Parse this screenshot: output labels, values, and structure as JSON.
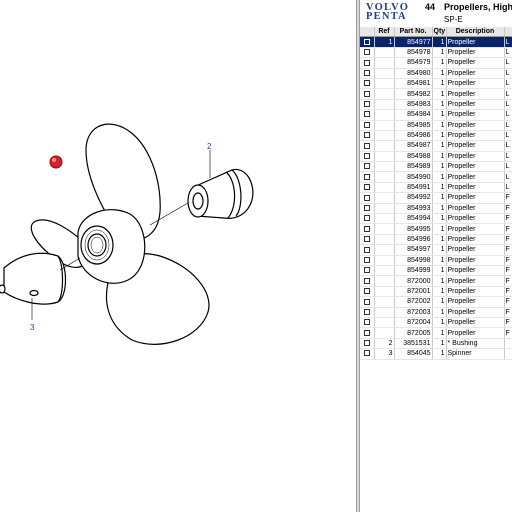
{
  "header": {
    "brand_line1": "VOLVO",
    "brand_line2": "PENTA",
    "group_no": "44",
    "title": "Propellers, High",
    "subtitle": "SP-E"
  },
  "columns": [
    "Ref",
    "Part No.",
    "Qty",
    "Description"
  ],
  "rows": [
    {
      "ref": "1",
      "part": "854977",
      "qty": "1",
      "desc": "Propeller",
      "extra": "L",
      "selected": true
    },
    {
      "ref": "",
      "part": "854978",
      "qty": "1",
      "desc": "Propeller",
      "extra": "L"
    },
    {
      "ref": "",
      "part": "854979",
      "qty": "1",
      "desc": "Propeller",
      "extra": "L"
    },
    {
      "ref": "",
      "part": "854980",
      "qty": "1",
      "desc": "Propeller",
      "extra": "L"
    },
    {
      "ref": "",
      "part": "854981",
      "qty": "1",
      "desc": "Propeller",
      "extra": "L"
    },
    {
      "ref": "",
      "part": "854982",
      "qty": "1",
      "desc": "Propeller",
      "extra": "L"
    },
    {
      "ref": "",
      "part": "854983",
      "qty": "1",
      "desc": "Propeller",
      "extra": "L"
    },
    {
      "ref": "",
      "part": "854984",
      "qty": "1",
      "desc": "Propeller",
      "extra": "L"
    },
    {
      "ref": "",
      "part": "854985",
      "qty": "1",
      "desc": "Propeller",
      "extra": "L"
    },
    {
      "ref": "",
      "part": "854986",
      "qty": "1",
      "desc": "Propeller",
      "extra": "L"
    },
    {
      "ref": "",
      "part": "854987",
      "qty": "1",
      "desc": "Propeller",
      "extra": "L"
    },
    {
      "ref": "",
      "part": "854988",
      "qty": "1",
      "desc": "Propeller",
      "extra": "L"
    },
    {
      "ref": "",
      "part": "854989",
      "qty": "1",
      "desc": "Propeller",
      "extra": "L"
    },
    {
      "ref": "",
      "part": "854990",
      "qty": "1",
      "desc": "Propeller",
      "extra": "L"
    },
    {
      "ref": "",
      "part": "854991",
      "qty": "1",
      "desc": "Propeller",
      "extra": "L"
    },
    {
      "ref": "",
      "part": "854992",
      "qty": "1",
      "desc": "Propeller",
      "extra": "F"
    },
    {
      "ref": "",
      "part": "854993",
      "qty": "1",
      "desc": "Propeller",
      "extra": "F"
    },
    {
      "ref": "",
      "part": "854994",
      "qty": "1",
      "desc": "Propeller",
      "extra": "F"
    },
    {
      "ref": "",
      "part": "854995",
      "qty": "1",
      "desc": "Propeller",
      "extra": "F"
    },
    {
      "ref": "",
      "part": "854996",
      "qty": "1",
      "desc": "Propeller",
      "extra": "F"
    },
    {
      "ref": "",
      "part": "854997",
      "qty": "1",
      "desc": "Propeller",
      "extra": "F"
    },
    {
      "ref": "",
      "part": "854998",
      "qty": "1",
      "desc": "Propeller",
      "extra": "F"
    },
    {
      "ref": "",
      "part": "854999",
      "qty": "1",
      "desc": "Propeller",
      "extra": "F"
    },
    {
      "ref": "",
      "part": "872000",
      "qty": "1",
      "desc": "Propeller",
      "extra": "F"
    },
    {
      "ref": "",
      "part": "872001",
      "qty": "1",
      "desc": "Propeller",
      "extra": "F"
    },
    {
      "ref": "",
      "part": "872002",
      "qty": "1",
      "desc": "Propeller",
      "extra": "F"
    },
    {
      "ref": "",
      "part": "872003",
      "qty": "1",
      "desc": "Propeller",
      "extra": "F"
    },
    {
      "ref": "",
      "part": "872004",
      "qty": "1",
      "desc": "Propeller",
      "extra": "F"
    },
    {
      "ref": "",
      "part": "872005",
      "qty": "1",
      "desc": "Propeller",
      "extra": "F"
    },
    {
      "ref": "2",
      "part": "3851531",
      "qty": "1",
      "desc": "* Bushing",
      "extra": ""
    },
    {
      "ref": "3",
      "part": "854045",
      "qty": "1",
      "desc": "Spinner",
      "extra": ""
    }
  ],
  "callouts": {
    "c2": "2",
    "c3": "3"
  },
  "colors": {
    "selection": "#0a246a",
    "brand": "#1b3f8b",
    "callout": "#2b3fa5",
    "marker": "#d8202a"
  }
}
